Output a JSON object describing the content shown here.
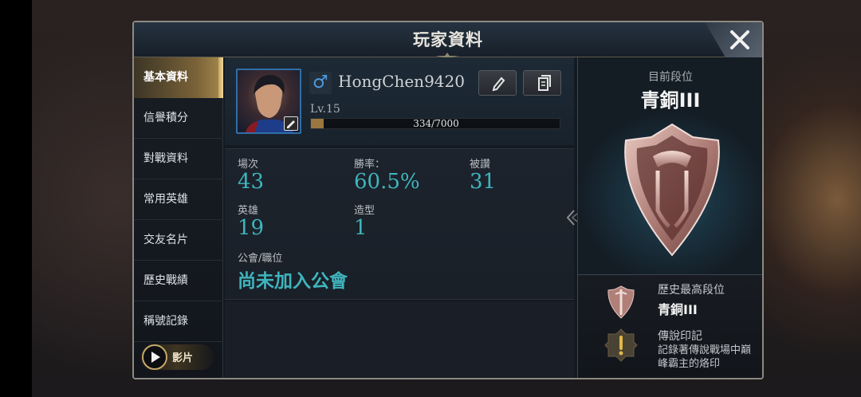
{
  "title": "玩家資料",
  "sidebar": {
    "items": [
      {
        "label": "基本資料"
      },
      {
        "label": "信譽積分"
      },
      {
        "label": "對戰資料"
      },
      {
        "label": "常用英雄"
      },
      {
        "label": "交友名片"
      },
      {
        "label": "歷史戰績"
      },
      {
        "label": "稱號記錄"
      }
    ],
    "video_label": "影片"
  },
  "profile": {
    "gender_symbol": "♂",
    "name": "HongChen9420",
    "level": "Lv.15",
    "xp_text": "334/7000",
    "xp_fraction": 0.0477
  },
  "stats": {
    "matches_label": "場次",
    "matches_value": "43",
    "winrate_label": "勝率：",
    "winrate_value": "60.5%",
    "likes_label": "被讚",
    "likes_value": "31",
    "heroes_label": "英雄",
    "heroes_value": "19",
    "skins_label": "造型",
    "skins_value": "1",
    "guild_label": "公會/職位",
    "guild_value": "尚未加入公會"
  },
  "rank": {
    "label": "目前段位",
    "name": "青銅III",
    "history_label": "歷史最高段位",
    "history_value": "青銅III",
    "legend_title": "傳說印記",
    "legend_desc": "記錄著傳說戰場中巔峰霸主的烙印"
  },
  "colors": {
    "accent_gold": "#c8a763",
    "stat_teal": "#3fb4bd",
    "xp_fill": "#9a7640"
  }
}
